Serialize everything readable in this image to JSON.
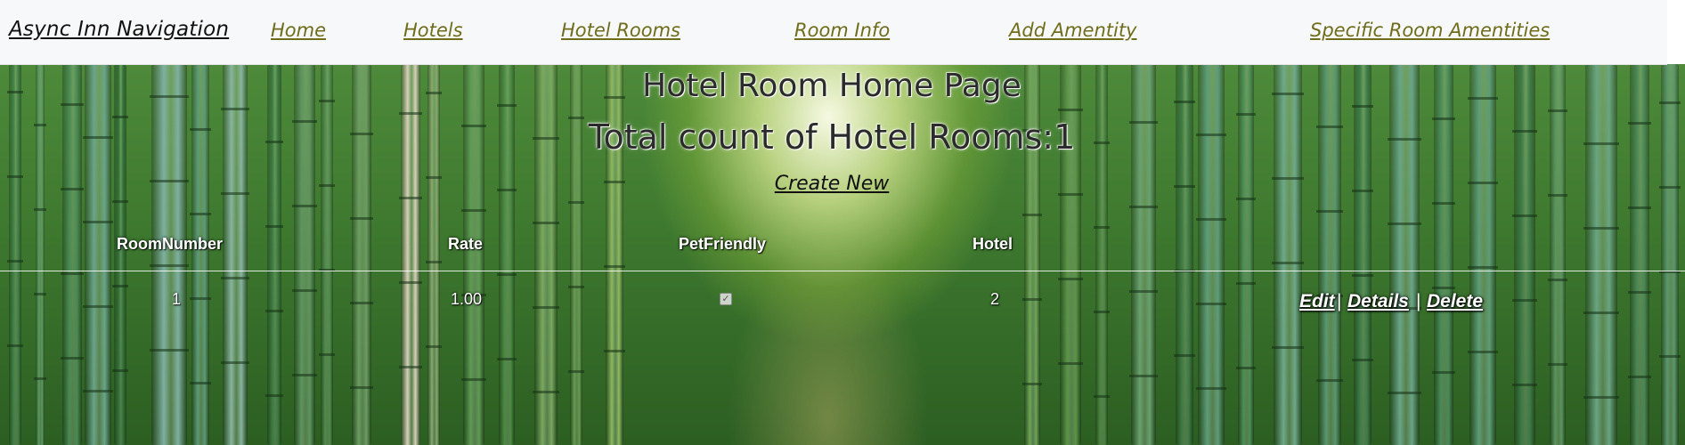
{
  "navbar": {
    "brand": "Async Inn Navigation",
    "links": [
      "Home",
      "Hotels",
      "Hotel Rooms",
      "Room Info",
      "Add Amentity",
      "Specific Room Amentities"
    ]
  },
  "page": {
    "title": "Hotel Room Home Page",
    "count_text": "Total count of Hotel Rooms:1",
    "create_link": "Create New"
  },
  "table": {
    "headers": [
      "RoomNumber",
      "Rate",
      "PetFriendly",
      "Hotel"
    ],
    "rows": [
      {
        "room_number": "1",
        "rate": "1.00",
        "pet_friendly": true,
        "hotel": "2",
        "actions": [
          "Edit",
          "Details",
          "Delete"
        ],
        "separator": "|"
      }
    ]
  },
  "colors": {
    "nav_link": "#6f6d1b",
    "navbar_bg": "#f7f8f9",
    "background": "bamboo-forest-green"
  }
}
